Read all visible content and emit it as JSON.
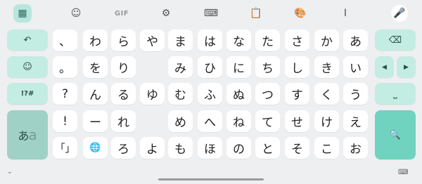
{
  "toolbar": {
    "items": [
      {
        "icon": "apps-grid-icon",
        "glyph": "▦",
        "active": true
      },
      {
        "icon": "sticker-icon",
        "glyph": "☺"
      },
      {
        "icon": "gif-icon",
        "glyph": "GIF"
      },
      {
        "icon": "settings-icon",
        "glyph": "⚙"
      },
      {
        "icon": "keyboard-icon",
        "glyph": "⌨"
      },
      {
        "icon": "clipboard-icon",
        "glyph": "📋"
      },
      {
        "icon": "palette-icon",
        "glyph": "🎨"
      },
      {
        "icon": "text-cursor-icon",
        "glyph": "Ⅰ"
      },
      {
        "icon": "microphone-icon",
        "glyph": "🎤"
      }
    ]
  },
  "left_keys": {
    "undo": "↶",
    "emoji": "☺",
    "symbols": "!?#",
    "mode_main": "あ",
    "mode_sub": "a"
  },
  "right_keys": {
    "backspace": "⌫",
    "cursor_left": "◀",
    "cursor_right": "▶",
    "space": "⎵",
    "search": "🔍"
  },
  "grid": [
    [
      "、",
      "わ",
      "ら",
      "や",
      "ま",
      "は",
      "な",
      "た",
      "さ",
      "か",
      "あ"
    ],
    [
      "。",
      "を",
      "り",
      "",
      "み",
      "ひ",
      "に",
      "ち",
      "し",
      "き",
      "い"
    ],
    [
      "?",
      "ん",
      "る",
      "ゆ",
      "む",
      "ふ",
      "ぬ",
      "つ",
      "す",
      "く",
      "う"
    ],
    [
      "!",
      "ー",
      "れ",
      "",
      "め",
      "へ",
      "ね",
      "て",
      "せ",
      "け",
      "え"
    ],
    [
      "「」",
      "🌐",
      "ろ",
      "よ",
      "も",
      "ほ",
      "の",
      "と",
      "そ",
      "こ",
      "お"
    ]
  ],
  "bottom": {
    "left": "⌄",
    "right": "⌨"
  }
}
